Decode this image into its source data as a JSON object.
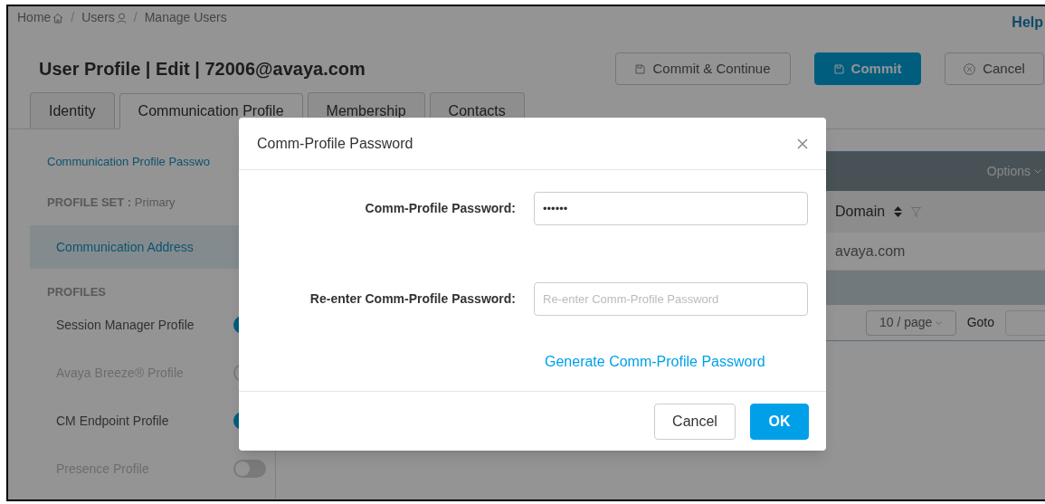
{
  "breadcrumb": [
    {
      "label": "Home",
      "kind": "home"
    },
    {
      "label": "Users",
      "kind": "user"
    },
    {
      "label": "Manage Users",
      "kind": "plain"
    }
  ],
  "breadcrumb_separator": "/",
  "help_link": "Help",
  "title": "User Profile | Edit | 72006@avaya.com",
  "actions": [
    {
      "label": "Commit & Continue",
      "kind": "secondary"
    },
    {
      "label": "Commit",
      "kind": "primary"
    },
    {
      "label": "Cancel",
      "kind": "cancel"
    }
  ],
  "tabs": [
    {
      "label": "Identity",
      "selected": false
    },
    {
      "label": "Communication Profile",
      "selected": true
    },
    {
      "label": "Membership",
      "selected": false
    },
    {
      "label": "Contacts",
      "selected": false
    }
  ],
  "sidebar": {
    "password_link": "Communication Profile Passwo",
    "profile_set": {
      "label": "PROFILE SET :",
      "value": "Primary"
    },
    "items": [
      {
        "label": "Communication Address",
        "selected": true
      }
    ],
    "profiles_heading": "PROFILES",
    "profiles": [
      {
        "label": "Session Manager Profile",
        "on": true,
        "disabled": false
      },
      {
        "label": "Avaya Breeze® Profile",
        "on": false,
        "disabled": true
      },
      {
        "label": "CM Endpoint Profile",
        "on": true,
        "disabled": false
      },
      {
        "label": "Presence Profile",
        "on": false,
        "disabled": true
      }
    ]
  },
  "table": {
    "options": "Options",
    "columns": [
      {
        "label": "Domain"
      }
    ],
    "rows": [
      [
        "avaya.com"
      ]
    ],
    "pagination": {
      "page_size": "10 / page",
      "goto_label": "Goto"
    }
  },
  "dialog": {
    "title": "Comm-Profile Password",
    "fields": [
      {
        "label": "Comm-Profile Password:",
        "value": "••••••"
      },
      {
        "label": "Re-enter Comm-Profile Password:",
        "placeholder": "Re-enter Comm-Profile Password"
      }
    ],
    "generate_link": "Generate Comm-Profile Password",
    "buttons": [
      {
        "label": "Cancel",
        "kind": "secondary"
      },
      {
        "label": "OK",
        "kind": "primary"
      }
    ]
  }
}
